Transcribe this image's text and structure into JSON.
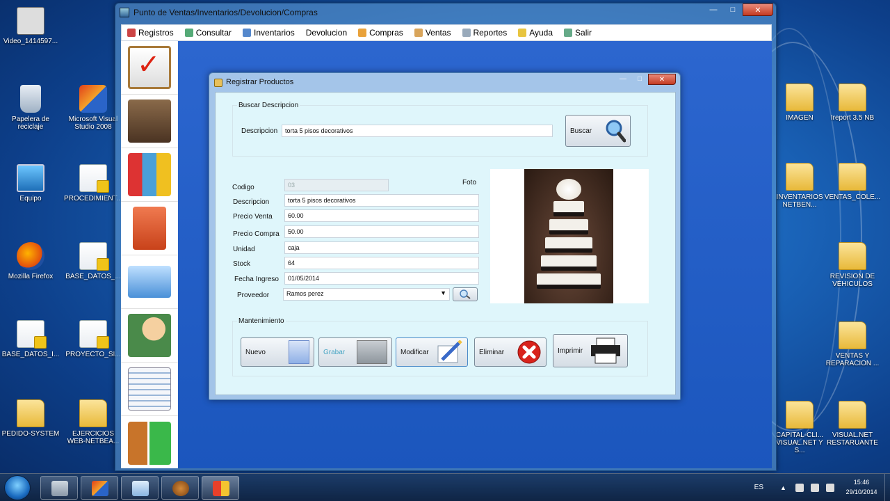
{
  "desktop": {
    "left_icons": [
      {
        "label": "Video_1414597..."
      },
      {
        "label": "Papelera de reciclaje"
      },
      {
        "label": "Microsoft Visual Studio 2008"
      },
      {
        "label": "Equipo"
      },
      {
        "label": "PROCEDIMIENT..."
      },
      {
        "label": "Mozilla Firefox"
      },
      {
        "label": "BASE_DATOS_..."
      },
      {
        "label": "BASE_DATOS_I..."
      },
      {
        "label": "PROYECTO_SI..."
      },
      {
        "label": "PEDIDO-SYSTEM"
      },
      {
        "label": "EJERCICIOS WEB-NETBEA..."
      }
    ],
    "right_icons": [
      {
        "label": "IMAGEN"
      },
      {
        "label": "Ireport 3.5 NB"
      },
      {
        "label": "INVENTARIOS NETBEN..."
      },
      {
        "label": "VENTAS_COLE..."
      },
      {
        "label": "REVISION DE VEHICULOS"
      },
      {
        "label": "VENTAS Y REPARACION ..."
      },
      {
        "label": "CAPITAL-CLI... VISUAL.NET Y S..."
      },
      {
        "label": "VISUAL.NET RESTARUANTE"
      }
    ]
  },
  "app": {
    "title": "Punto de Ventas/Inventarios/Devolucion/Compras",
    "menu": [
      {
        "label": "Registros",
        "icon": "registros-icon"
      },
      {
        "label": "Consultar",
        "icon": "consultar-icon"
      },
      {
        "label": "Inventarios",
        "icon": "inventarios-icon"
      },
      {
        "label": "Devolucion",
        "icon": ""
      },
      {
        "label": "Compras",
        "icon": "compras-icon"
      },
      {
        "label": "Ventas",
        "icon": "ventas-icon"
      },
      {
        "label": "Reportes",
        "icon": "reportes-icon"
      },
      {
        "label": "Ayuda",
        "icon": "ayuda-icon"
      },
      {
        "label": "Salir",
        "icon": "salir-icon"
      }
    ]
  },
  "form": {
    "title": "Registrar Productos",
    "search_group": {
      "label": "Buscar Descripcion",
      "field_label": "Descripcion",
      "field_value": "torta 5 pisos decorativos",
      "button": "Buscar"
    },
    "fields": {
      "codigo": {
        "label": "Codigo",
        "value": "03"
      },
      "descripcion": {
        "label": "Descripcion",
        "value": "torta 5 pisos decorativos"
      },
      "precio_venta": {
        "label": "Precio Venta",
        "value": "60.00"
      },
      "precio_compra": {
        "label": "Precio Compra",
        "value": "50.00"
      },
      "unidad": {
        "label": "Unidad",
        "value": "caja"
      },
      "stock": {
        "label": "Stock",
        "value": "64"
      },
      "fecha_ingreso": {
        "label": "Fecha Ingreso",
        "value": "01/05/2014"
      },
      "proveedor": {
        "label": "Proveedor",
        "value": "Ramos perez"
      }
    },
    "foto_label": "Foto",
    "maintenance": {
      "label": "Mantenimiento",
      "buttons": {
        "nuevo": "Nuevo",
        "grabar": "Grabar",
        "modificar": "Modificar",
        "eliminar": "Eliminar",
        "imprimir": "Imprimir"
      }
    }
  },
  "taskbar": {
    "language": "ES",
    "time": "15:46",
    "date": "29/10/2014"
  },
  "colors": {
    "client_bg": "#dff6fb",
    "desktop_blue": "#1a63b8",
    "close_red": "#c43b22"
  }
}
